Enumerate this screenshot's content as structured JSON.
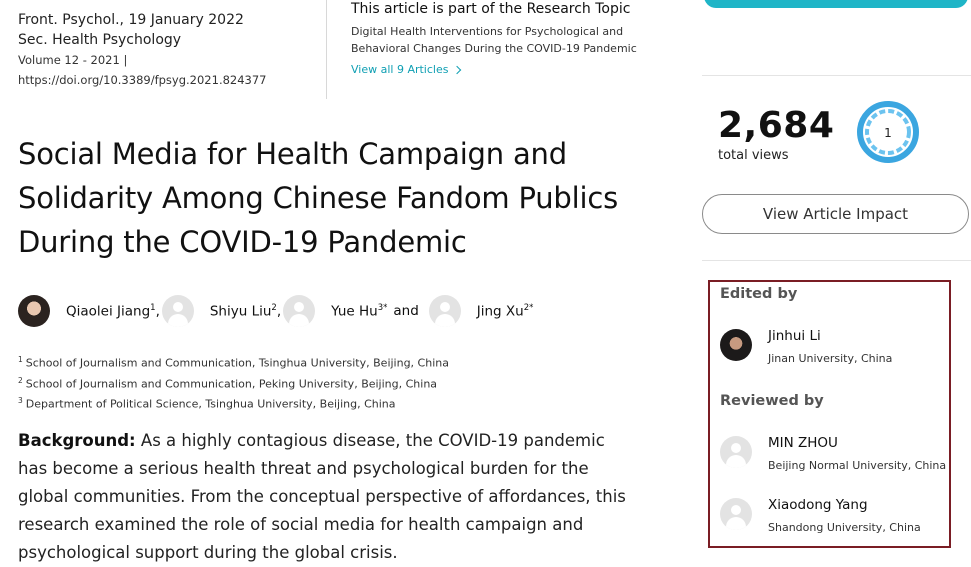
{
  "meta": {
    "journal_date": "Front. Psychol., 19 January 2022",
    "section": "Sec. Health Psychology",
    "volume": "Volume 12 - 2021 |",
    "doi": "https://doi.org/10.3389/fpsyg.2021.824377"
  },
  "topic": {
    "part_of": "This article is part of the Research Topic",
    "name": "Digital Health Interventions for Psychological and Behavioral Changes During the COVID-19 Pandemic",
    "view_all": "View all 9 Articles"
  },
  "article": {
    "title": "Social Media for Health Campaign and Solidarity Among Chinese Fandom Publics During the COVID-19 Pandemic",
    "authors": [
      {
        "name": "Qiaolei Jiang",
        "sup": "1",
        "sep": ","
      },
      {
        "name": "Shiyu Liu",
        "sup": "2",
        "sep": ","
      },
      {
        "name": "Yue Hu",
        "sup": "3*",
        "sep": ""
      },
      {
        "name": "Jing Xu",
        "sup": "2*",
        "sep": ""
      }
    ],
    "and": "and",
    "affiliations": [
      {
        "num": "1",
        "text": "School of Journalism and Communication, Tsinghua University, Beijing, China"
      },
      {
        "num": "2",
        "text": "School of Journalism and Communication, Peking University, Beijing, China"
      },
      {
        "num": "3",
        "text": "Department of Political Science, Tsinghua University, Beijing, China"
      }
    ],
    "abstract_label": "Background:",
    "abstract_text": "As a highly contagious disease, the COVID-19 pandemic has become a serious health threat and psychological burden for the global communities. From the conceptual perspective of affordances, this research examined the role of social media for health campaign and psychological support during the global crisis."
  },
  "stats": {
    "views": "2,684",
    "views_label": "total views",
    "altmetric_score": "1",
    "impact_button": "View Article Impact"
  },
  "editors": {
    "edited_heading": "Edited by",
    "editor": {
      "name": "Jinhui Li",
      "affiliation": "Jinan University, China"
    },
    "reviewed_heading": "Reviewed by",
    "reviewers": [
      {
        "name": "MIN ZHOU",
        "affiliation": "Beijing Normal University, China"
      },
      {
        "name": "Xiaodong Yang",
        "affiliation": "Shandong University, China"
      }
    ]
  },
  "colors": {
    "accent": "#1fb5c7",
    "link": "#0f9fb3",
    "altmetric": "#3ba6e0",
    "box_border": "#7a1d24"
  }
}
